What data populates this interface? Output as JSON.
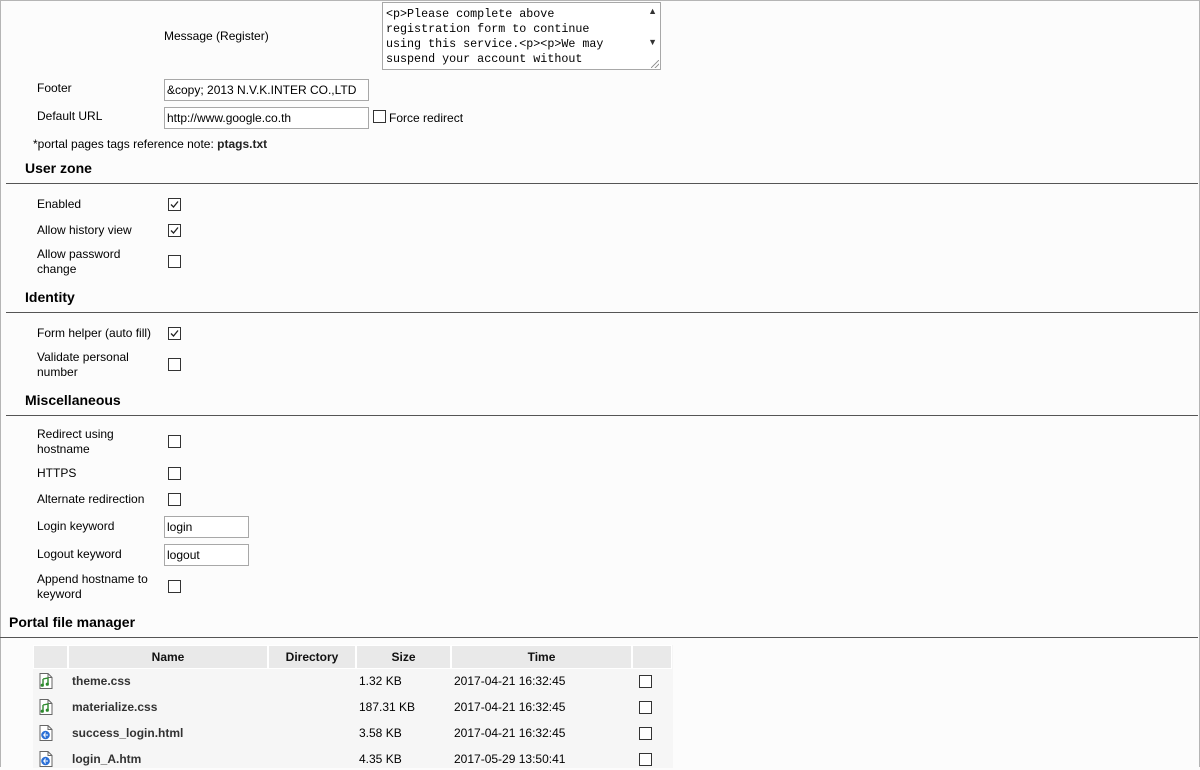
{
  "message_register": {
    "label": "Message (Register)",
    "value": "<p>Please complete above\nregistration form to continue\nusing this service.<p><p>We may\nsuspend your account without"
  },
  "footer": {
    "label": "Footer",
    "value": "&copy; 2013  N.V.K.INTER CO.,LTD"
  },
  "default_url": {
    "label": "Default URL",
    "value": "http://www.google.co.th",
    "force_redirect_label": "Force redirect",
    "force_redirect_checked": false
  },
  "note": {
    "text": "*portal pages tags reference note: ",
    "link": "ptags.txt"
  },
  "user_zone": {
    "title": "User zone",
    "enabled": {
      "label": "Enabled",
      "checked": true
    },
    "allow_history": {
      "label": "Allow history view",
      "checked": true
    },
    "allow_password_line1": "Allow password",
    "allow_password_line2": "change",
    "allow_password_checked": false
  },
  "identity": {
    "title": "Identity",
    "form_helper": {
      "label": "Form helper (auto fill)",
      "checked": true
    },
    "validate_line1": "Validate personal",
    "validate_line2": "number",
    "validate_checked": false
  },
  "misc": {
    "title": "Miscellaneous",
    "redirect_host_line1": "Redirect using",
    "redirect_host_line2": "hostname",
    "https": "HTTPS",
    "alternate": "Alternate redirection",
    "login_keyword": {
      "label": "Login keyword",
      "value": "login"
    },
    "logout_keyword": {
      "label": "Logout keyword",
      "value": "logout"
    },
    "append_line1": "Append hostname to",
    "append_line2": "keyword"
  },
  "file_manager": {
    "title": "Portal file manager",
    "columns": [
      "Name",
      "Directory",
      "Size",
      "Time"
    ],
    "rows": [
      {
        "name": "theme.css",
        "directory": "",
        "size": "1.32 KB",
        "time": "2017-04-21 16:32:45",
        "icon": "css-file-icon"
      },
      {
        "name": "materialize.css",
        "directory": "",
        "size": "187.31 KB",
        "time": "2017-04-21 16:32:45",
        "icon": "css-file-icon"
      },
      {
        "name": "success_login.html",
        "directory": "",
        "size": "3.58 KB",
        "time": "2017-04-21 16:32:45",
        "icon": "html-file-icon"
      },
      {
        "name": "login_A.htm",
        "directory": "",
        "size": "4.35 KB",
        "time": "2017-05-29 13:50:41",
        "icon": "html-file-icon"
      }
    ]
  }
}
